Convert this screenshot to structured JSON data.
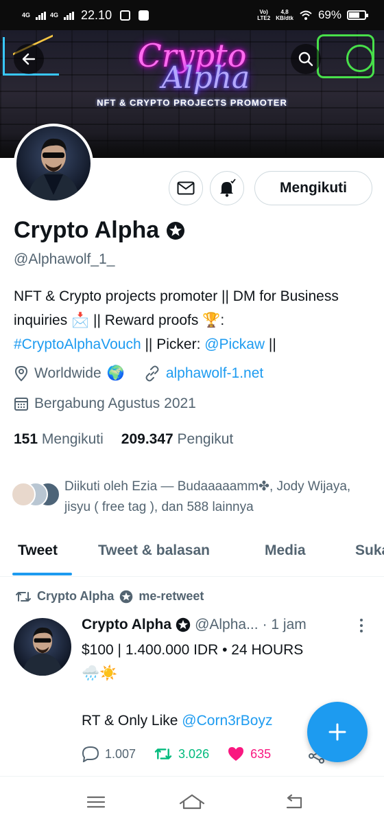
{
  "status_bar": {
    "network1": "4G",
    "network2": "4G",
    "time": "22.10",
    "volte": "Vo)\nLTE2",
    "speed_value": "4,8",
    "speed_unit": "KB/dtk",
    "battery": "69%",
    "battery_level": 0.69
  },
  "banner": {
    "title_line1": "Crypto",
    "title_line2": "Alpha",
    "subtitle": "NFT & CRYPTO PROJECTS PROMOTER"
  },
  "profile": {
    "name": "Crypto Alpha",
    "handle": "@Alphawolf_1_",
    "bio_parts": {
      "p1": "NFT & Crypto projects promoter || DM for Business inquiries ",
      "emoji1": "📩",
      "p2": " || Reward proofs ",
      "emoji2": "🏆",
      "p3": ":",
      "hashtag": "#CryptoAlphaVouch",
      "p4": " || Picker: ",
      "mention": "@Pickaw",
      "p5": " ||"
    },
    "location": "Worldwide",
    "location_emoji": "🌍",
    "website": "alphawolf-1.net",
    "joined": "Bergabung Agustus 2021",
    "following_count": "151",
    "following_label": "Mengikuti",
    "followers_count": "209.347",
    "followers_label": "Pengikut",
    "followed_by": "Diikuti oleh Ezia — Budaaaaamm✤, Jody Wijaya, jisyu ( free tag ), dan 588 lainnya"
  },
  "actions": {
    "follow_label": "Mengikuti"
  },
  "tabs": [
    "Tweet",
    "Tweet & balasan",
    "Media",
    "Suka"
  ],
  "tweet": {
    "retweet_label_name": "Crypto Alpha",
    "retweet_label_suffix": "me-retweet",
    "name": "Crypto Alpha",
    "handle": "@Alpha...",
    "time": "· 1 jam",
    "text_line1": "$100 | 1.400.000 IDR • 24 HOURS",
    "text_emoji": "🌧️☀️",
    "text_line3_prefix": "RT & Only Like ",
    "text_line3_mention": "@Corn3rBoyz",
    "reply_count": "1.007",
    "retweet_count": "3.026",
    "like_count": "635"
  },
  "colors": {
    "accent": "#1d9bf0",
    "retweet_green": "#00ba7c",
    "like_pink": "#f91880",
    "secondary_text": "#536471"
  },
  "icons": [
    "back-arrow-icon",
    "search-icon",
    "mail-icon",
    "bell-icon",
    "verified-icon",
    "location-icon",
    "link-icon",
    "calendar-icon",
    "retweet-icon",
    "reply-icon",
    "like-icon",
    "share-icon",
    "more-icon",
    "plus-icon",
    "menu-icon",
    "home-icon",
    "back-nav-icon"
  ]
}
